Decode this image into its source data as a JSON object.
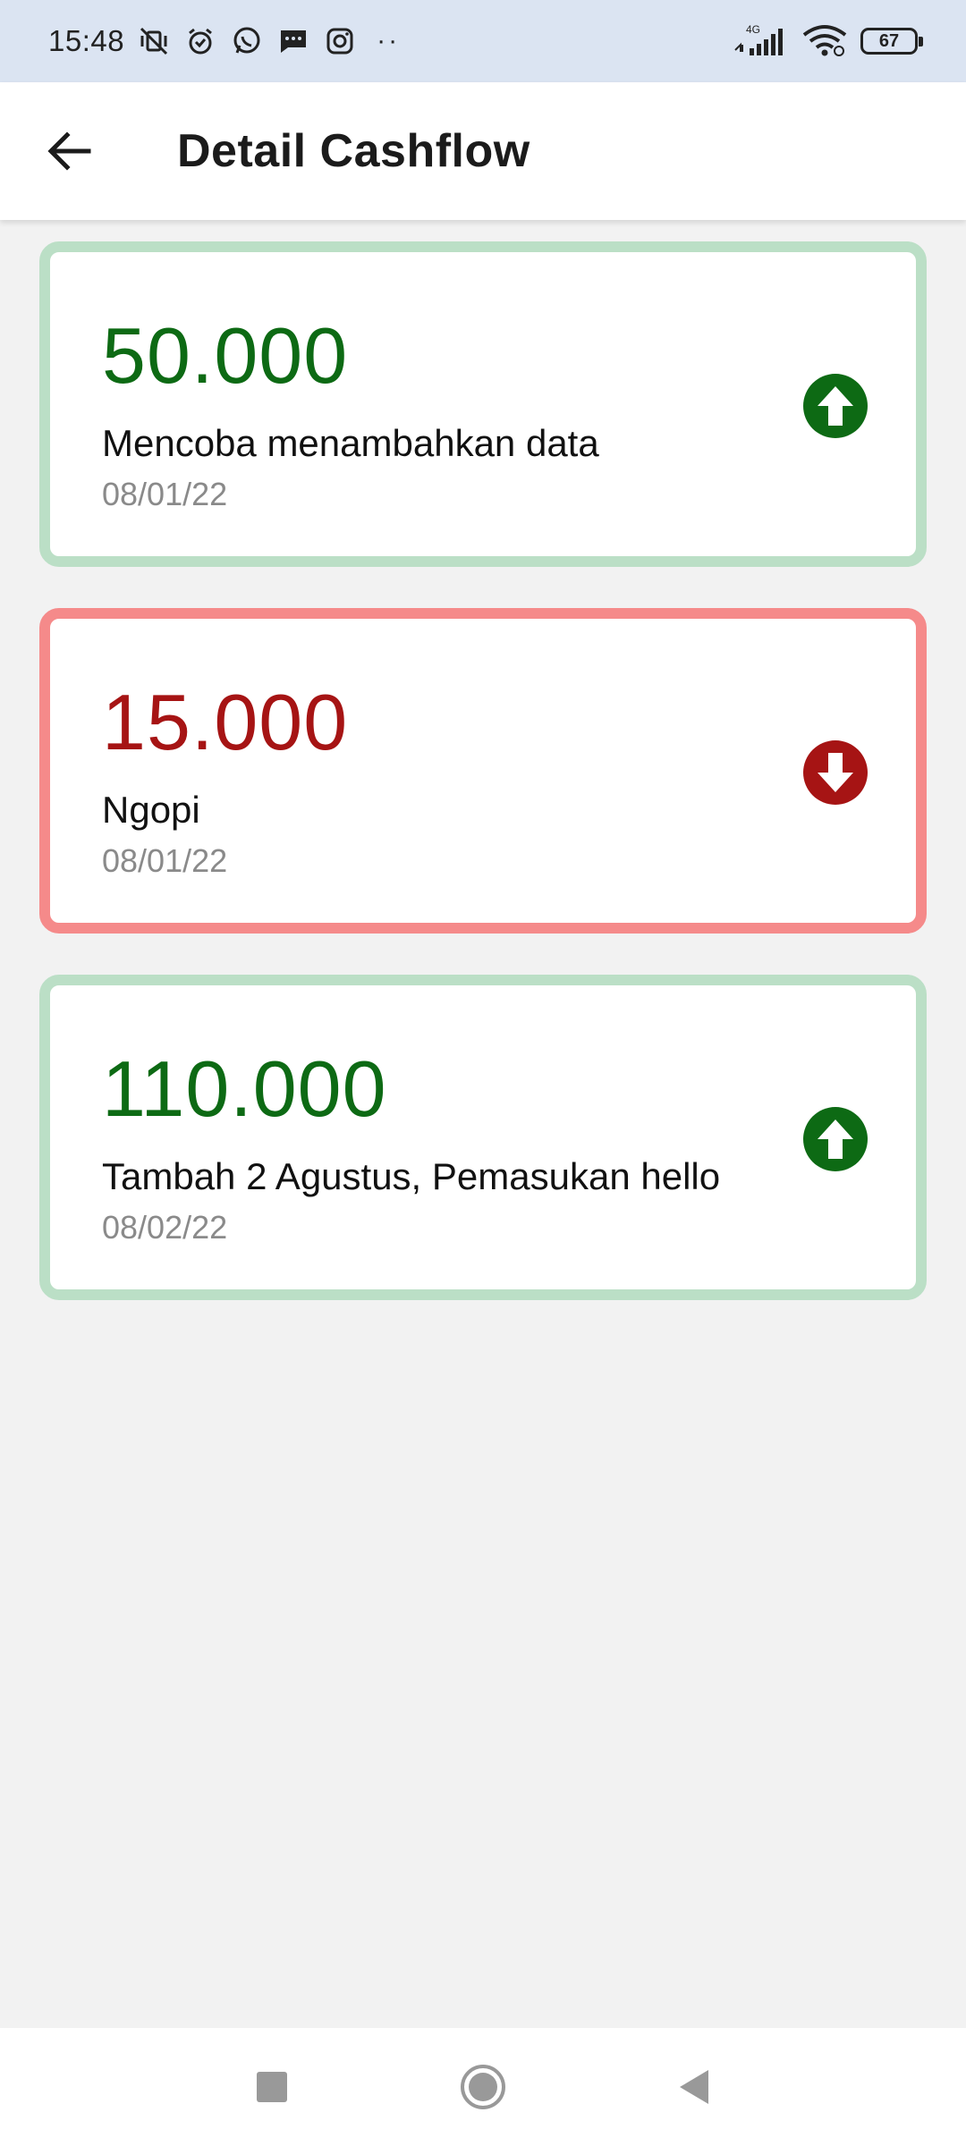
{
  "status_bar": {
    "time": "15:48",
    "network": "4G",
    "battery": "67"
  },
  "app_bar": {
    "title": "Detail Cashflow"
  },
  "colors": {
    "income_text": "#0d6a14",
    "income_border": "#bbdfc6",
    "expense_text": "#a61414",
    "expense_border": "#f58a8a"
  },
  "cashflows": [
    {
      "amount": "50.000",
      "description": "Mencoba menambahkan data",
      "date": "08/01/22",
      "type": "income",
      "icon": "arrow-up-circle-icon"
    },
    {
      "amount": "15.000",
      "description": "Ngopi",
      "date": "08/01/22",
      "type": "expense",
      "icon": "arrow-down-circle-icon"
    },
    {
      "amount": "110.000",
      "description": "Tambah 2 Agustus, Pemasukan hello",
      "date": "08/02/22",
      "type": "income",
      "icon": "arrow-up-circle-icon"
    }
  ]
}
